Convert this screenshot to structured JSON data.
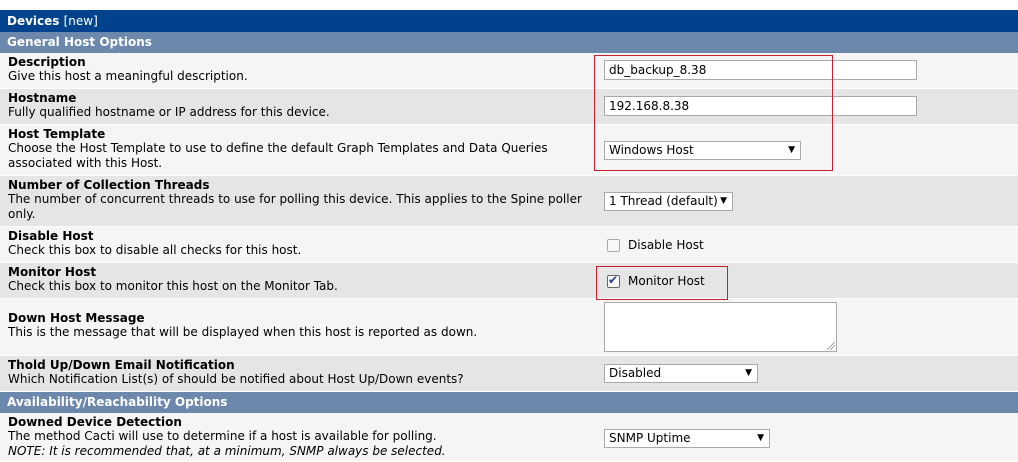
{
  "title_bar": {
    "title": "Devices",
    "tag": "[new]"
  },
  "sections": {
    "general": "General Host Options",
    "availability": "Availability/Reachability Options"
  },
  "fields": {
    "description": {
      "title": "Description",
      "desc": "Give this host a meaningful description.",
      "value": "db_backup_8.38"
    },
    "hostname": {
      "title": "Hostname",
      "desc": "Fully qualified hostname or IP address for this device.",
      "value": "192.168.8.38"
    },
    "host_template": {
      "title": "Host Template",
      "desc": "Choose the Host Template to use to define the default Graph Templates and Data Queries associated with this Host.",
      "value": "Windows Host"
    },
    "threads": {
      "title": "Number of Collection Threads",
      "desc": "The number of concurrent threads to use for polling this device. This applies to the Spine poller only.",
      "value": "1 Thread (default)"
    },
    "disable_host": {
      "title": "Disable Host",
      "desc": "Check this box to disable all checks for this host.",
      "checkbox_label": "Disable Host",
      "checked": false
    },
    "monitor_host": {
      "title": "Monitor Host",
      "desc": "Check this box to monitor this host on the Monitor Tab.",
      "checkbox_label": "Monitor Host",
      "checked": true
    },
    "down_message": {
      "title": "Down Host Message",
      "desc": "This is the message that will be displayed when this host is reported as down.",
      "value": ""
    },
    "thold_notification": {
      "title": "Thold Up/Down Email Notification",
      "desc": "Which Notification List(s) of should be notified about Host Up/Down events?",
      "value": "Disabled"
    },
    "downed_detection": {
      "title": "Downed Device Detection",
      "desc": "The method Cacti will use to determine if a host is available for polling.",
      "note": "NOTE: It is recommended that, at a minimum, SNMP always be selected.",
      "value": "SNMP Uptime"
    }
  },
  "icons": {
    "dropdown": "chevron-down-icon",
    "check": "checkmark-icon",
    "resize": "resize-grip-icon"
  },
  "colors": {
    "title_bar": "#00438c",
    "section_header": "#6d88ad",
    "row_alt": "#e5e5e5",
    "row_plain": "#f5f5f5",
    "highlight": "#c8202a"
  }
}
